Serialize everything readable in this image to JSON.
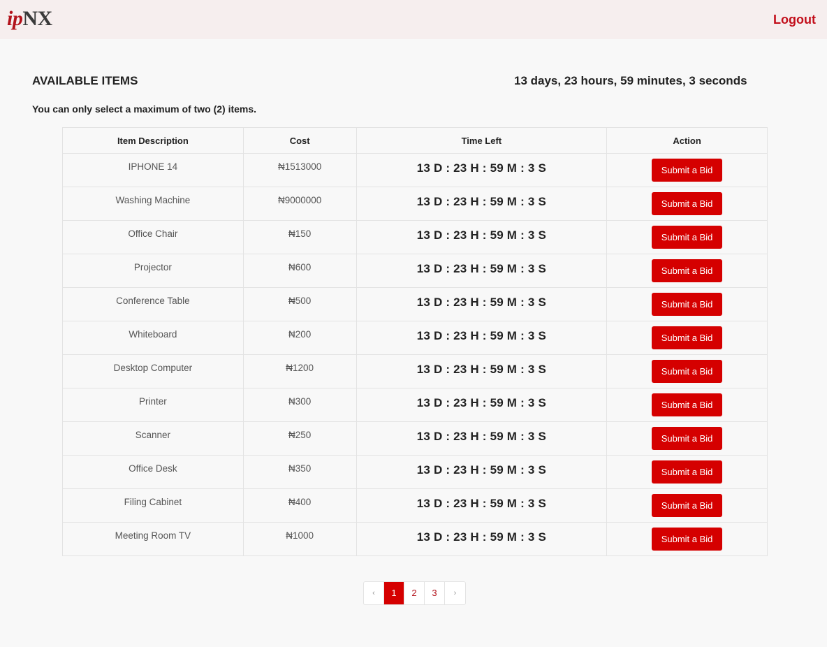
{
  "header": {
    "logo_ip": "ip",
    "logo_nx": "NX",
    "logout_label": "Logout"
  },
  "main": {
    "title": "AVAILABLE ITEMS",
    "countdown": "13 days, 23 hours, 59 minutes, 3 seconds",
    "note": "You can only select a maximum of two (2) items."
  },
  "table": {
    "headers": [
      "Item Description",
      "Cost",
      "Time Left",
      "Action"
    ],
    "rows": [
      {
        "description": "IPHONE 14",
        "cost": "₦1513000",
        "time_left": "13 D : 23 H : 59 M : 3 S",
        "action": "Submit a Bid"
      },
      {
        "description": "Washing Machine",
        "cost": "₦9000000",
        "time_left": "13 D : 23 H : 59 M : 3 S",
        "action": "Submit a Bid"
      },
      {
        "description": "Office Chair",
        "cost": "₦150",
        "time_left": "13 D : 23 H : 59 M : 3 S",
        "action": "Submit a Bid"
      },
      {
        "description": "Projector",
        "cost": "₦600",
        "time_left": "13 D : 23 H : 59 M : 3 S",
        "action": "Submit a Bid"
      },
      {
        "description": "Conference Table",
        "cost": "₦500",
        "time_left": "13 D : 23 H : 59 M : 3 S",
        "action": "Submit a Bid"
      },
      {
        "description": "Whiteboard",
        "cost": "₦200",
        "time_left": "13 D : 23 H : 59 M : 3 S",
        "action": "Submit a Bid"
      },
      {
        "description": "Desktop Computer",
        "cost": "₦1200",
        "time_left": "13 D : 23 H : 59 M : 3 S",
        "action": "Submit a Bid"
      },
      {
        "description": "Printer",
        "cost": "₦300",
        "time_left": "13 D : 23 H : 59 M : 3 S",
        "action": "Submit a Bid"
      },
      {
        "description": "Scanner",
        "cost": "₦250",
        "time_left": "13 D : 23 H : 59 M : 3 S",
        "action": "Submit a Bid"
      },
      {
        "description": "Office Desk",
        "cost": "₦350",
        "time_left": "13 D : 23 H : 59 M : 3 S",
        "action": "Submit a Bid"
      },
      {
        "description": "Filing Cabinet",
        "cost": "₦400",
        "time_left": "13 D : 23 H : 59 M : 3 S",
        "action": "Submit a Bid"
      },
      {
        "description": "Meeting Room TV",
        "cost": "₦1000",
        "time_left": "13 D : 23 H : 59 M : 3 S",
        "action": "Submit a Bid"
      }
    ]
  },
  "pagination": {
    "prev": "‹",
    "pages": [
      "1",
      "2",
      "3"
    ],
    "next": "›",
    "current": "1"
  },
  "colors": {
    "accent": "#d50000",
    "brand": "#b3121b",
    "topbar_bg": "#f6eeee"
  }
}
